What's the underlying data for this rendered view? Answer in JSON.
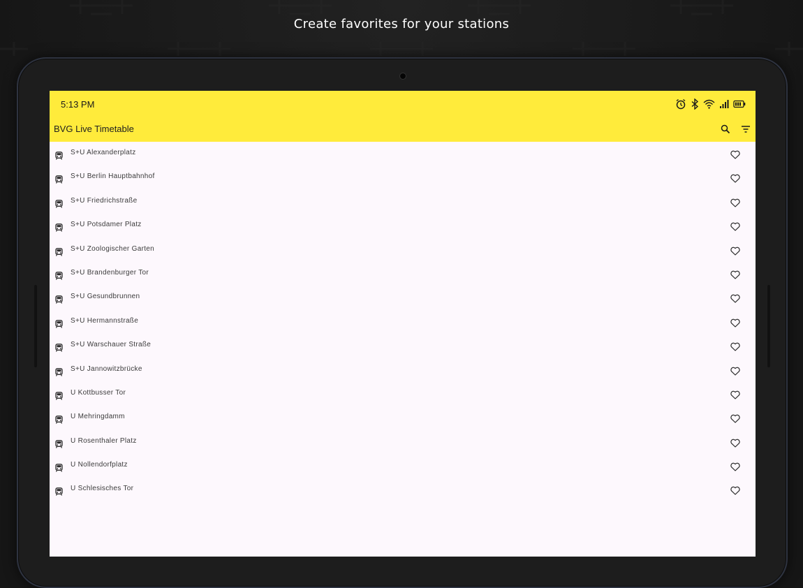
{
  "headline": "Create favorites for your stations",
  "status_bar": {
    "time": "5:13 PM",
    "icons": [
      "alarm-icon",
      "bluetooth-icon",
      "wifi-icon",
      "cellular-signal-icon",
      "battery-icon"
    ]
  },
  "toolbar": {
    "title": "BVG Live Timetable",
    "actions": [
      "search-icon",
      "filter-icon"
    ]
  },
  "colors": {
    "accent": "#ffeb3b",
    "list_background": "#fdf8fd",
    "frame_background": "#161616"
  },
  "stations": [
    {
      "name": "S+U Alexanderplatz",
      "icon": "train-icon",
      "favorite": false
    },
    {
      "name": "S+U Berlin Hauptbahnhof",
      "icon": "train-icon",
      "favorite": false
    },
    {
      "name": "S+U Friedrichstraße",
      "icon": "train-icon",
      "favorite": false
    },
    {
      "name": "S+U Potsdamer Platz",
      "icon": "train-icon",
      "favorite": false
    },
    {
      "name": "S+U Zoologischer Garten",
      "icon": "train-icon",
      "favorite": false
    },
    {
      "name": "S+U Brandenburger Tor",
      "icon": "train-icon",
      "favorite": false
    },
    {
      "name": "S+U Gesundbrunnen",
      "icon": "train-icon",
      "favorite": false
    },
    {
      "name": "S+U Hermannstraße",
      "icon": "train-icon",
      "favorite": false
    },
    {
      "name": "S+U Warschauer Straße",
      "icon": "train-icon",
      "favorite": false
    },
    {
      "name": "S+U Jannowitzbrücke",
      "icon": "train-icon",
      "favorite": false
    },
    {
      "name": "U Kottbusser Tor",
      "icon": "train-icon",
      "favorite": false
    },
    {
      "name": "U Mehringdamm",
      "icon": "train-icon",
      "favorite": false
    },
    {
      "name": "U Rosenthaler Platz",
      "icon": "train-icon",
      "favorite": false
    },
    {
      "name": "U Nollendorfplatz",
      "icon": "train-icon",
      "favorite": false
    },
    {
      "name": "U Schlesisches Tor",
      "icon": "train-icon",
      "favorite": false
    }
  ]
}
